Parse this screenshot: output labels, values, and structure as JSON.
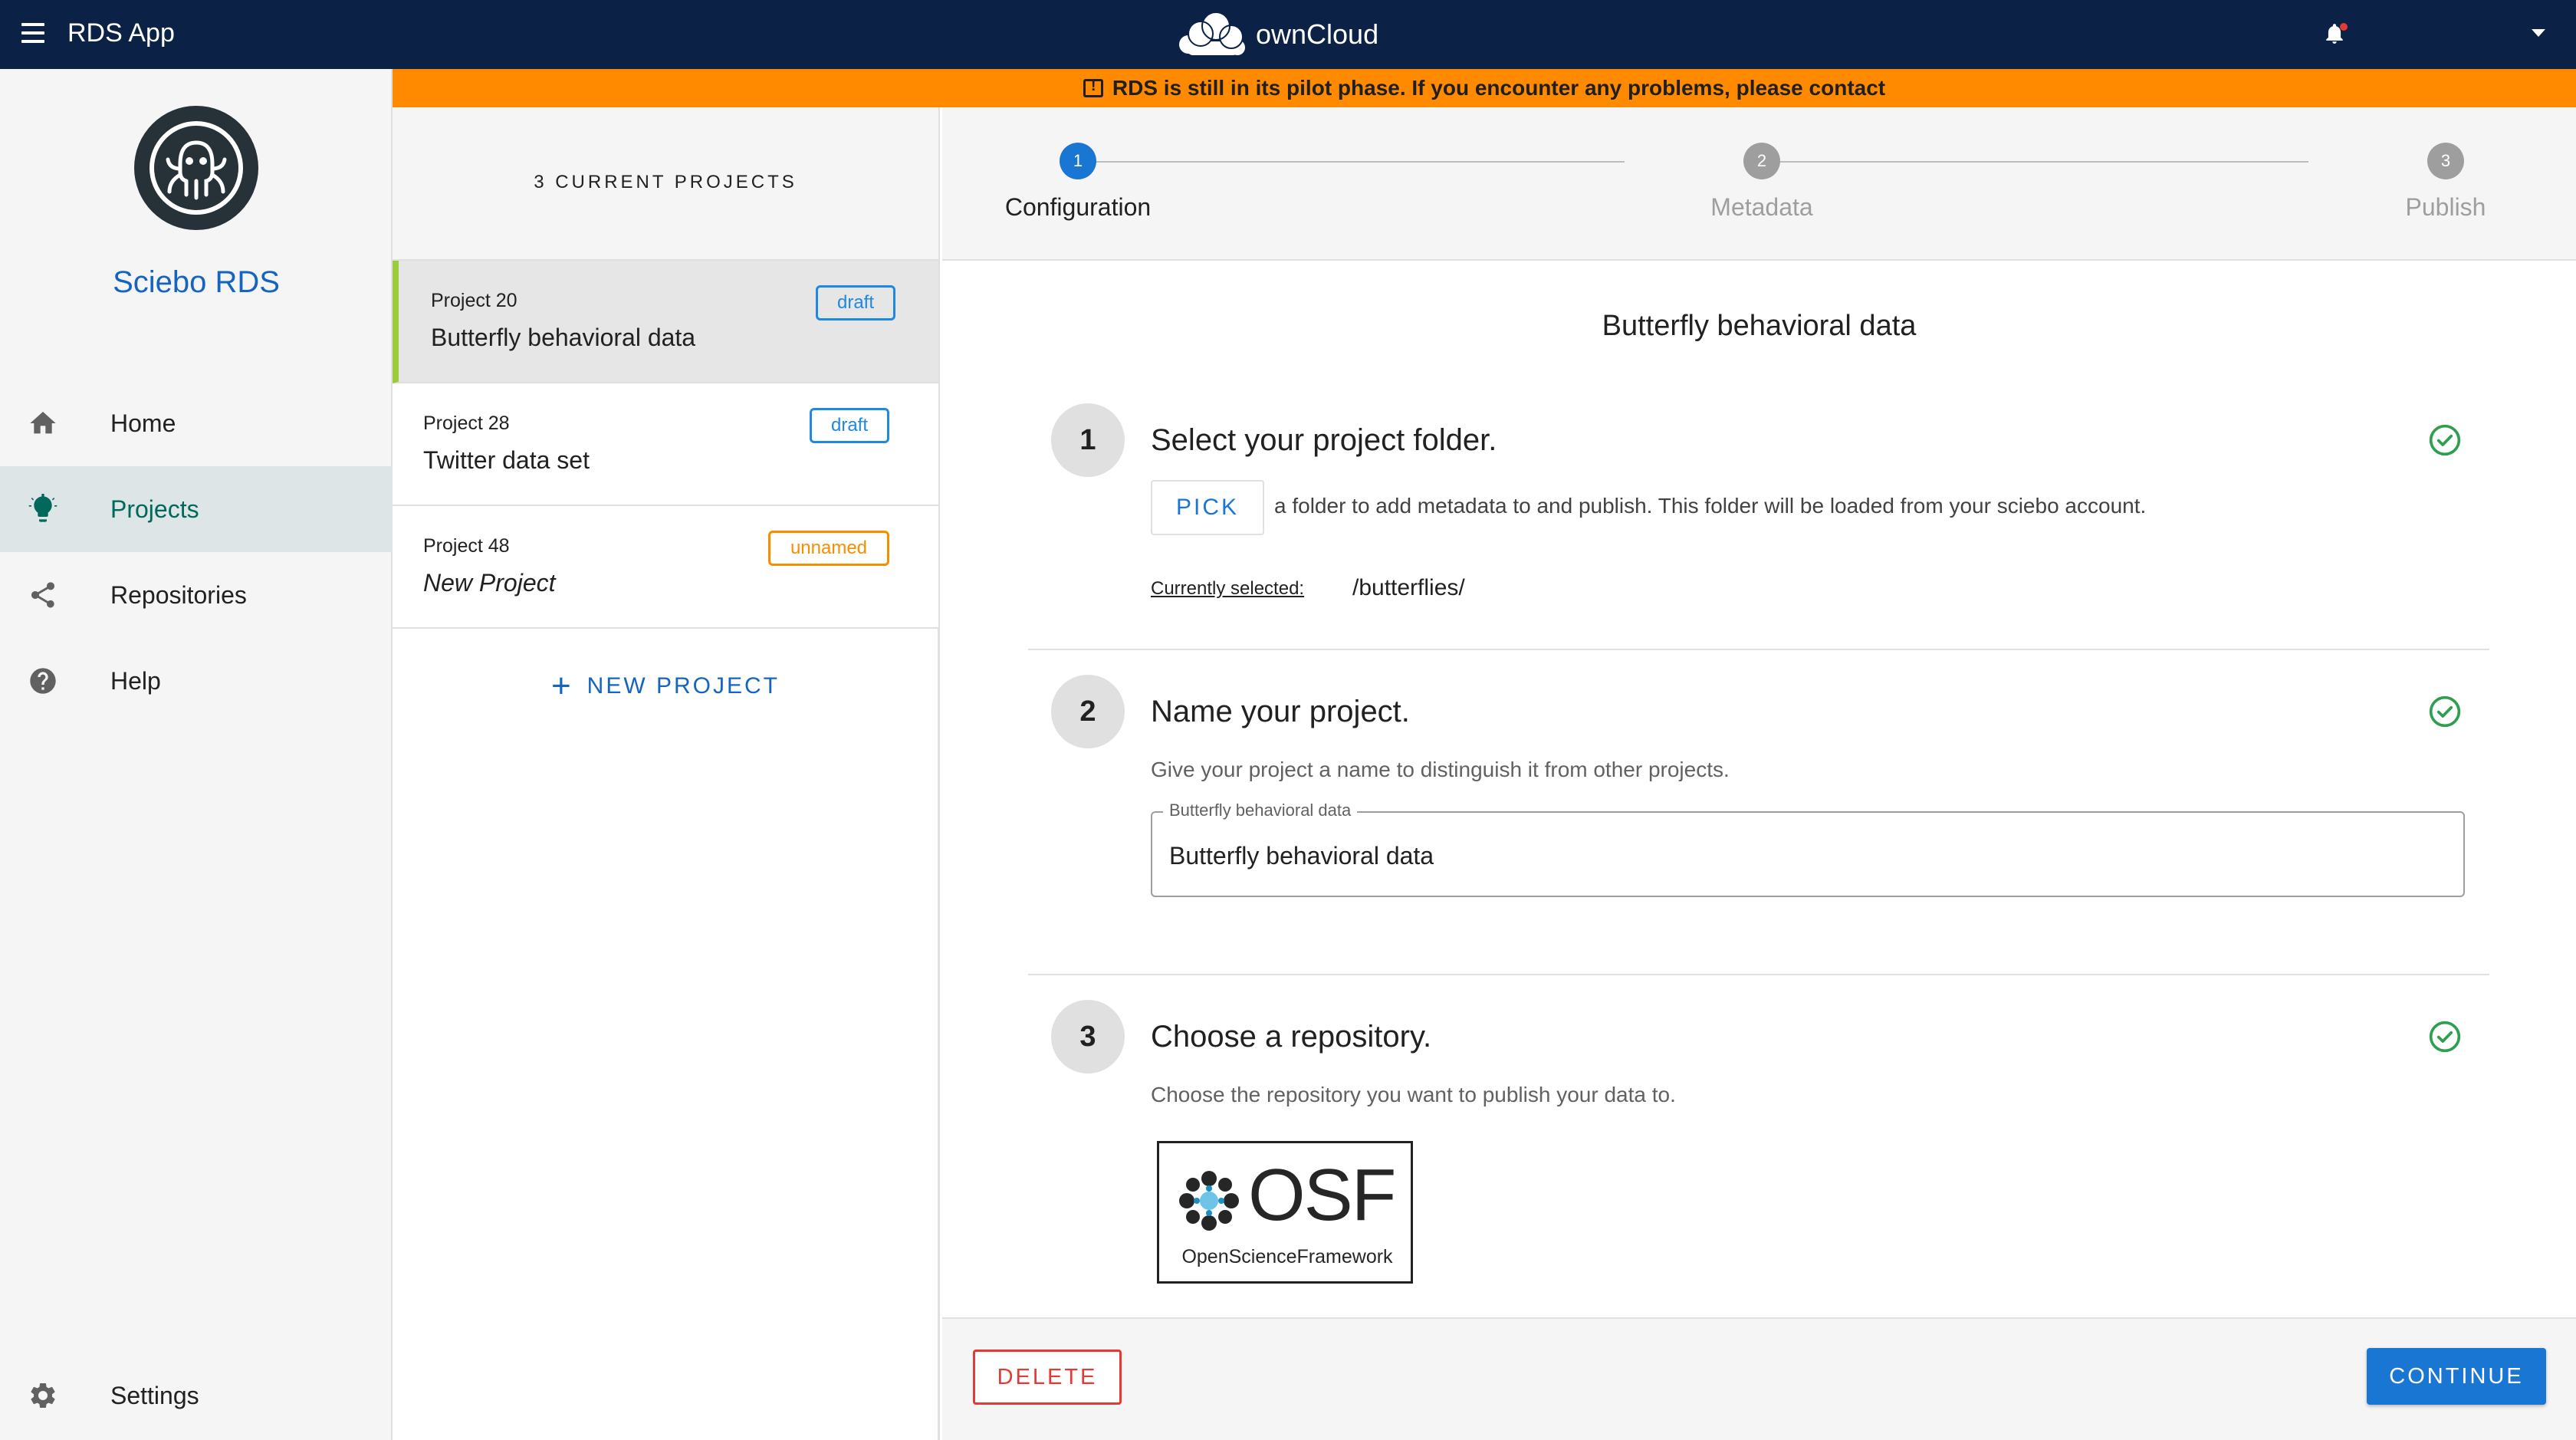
{
  "topbar": {
    "app_title": "RDS App",
    "brand_name": "ownCloud",
    "icons": [
      "menu-icon",
      "owncloud-logo-icon",
      "bell-icon",
      "chevron-down-icon"
    ]
  },
  "banner": {
    "text": "RDS is still in its pilot phase. If you encounter any problems, please contact",
    "color": "#ff8a00"
  },
  "sidebar": {
    "title": "Sciebo RDS",
    "items": [
      {
        "label": "Home",
        "icon": "home-icon"
      },
      {
        "label": "Projects",
        "icon": "lightbulb-icon",
        "active": true
      },
      {
        "label": "Repositories",
        "icon": "share-icon"
      },
      {
        "label": "Help",
        "icon": "help-icon"
      }
    ],
    "settings": {
      "label": "Settings",
      "icon": "gear-icon"
    }
  },
  "projects": {
    "count_label": "3 CURRENT PROJECTS",
    "items": [
      {
        "number": "Project 20",
        "name": "Butterfly behavioral data",
        "status": "draft",
        "selected": true
      },
      {
        "number": "Project 28",
        "name": "Twitter data set",
        "status": "draft"
      },
      {
        "number": "Project 48",
        "name": "New Project",
        "status": "unnamed"
      }
    ],
    "new_label": "NEW PROJECT"
  },
  "stepper": {
    "steps": [
      {
        "num": "1",
        "label": "Configuration",
        "active": true
      },
      {
        "num": "2",
        "label": "Metadata"
      },
      {
        "num": "3",
        "label": "Publish"
      }
    ]
  },
  "form": {
    "title": "Butterfly behavioral data",
    "sections": [
      {
        "num": "1",
        "title": "Select your project folder.",
        "pick_label": "PICK",
        "pick_desc": "a folder to add metadata to and publish. This folder will be loaded from your sciebo account.",
        "selected_label": "Currently selected:",
        "selected_value": "/butterflies/",
        "complete": true
      },
      {
        "num": "2",
        "title": "Name your project.",
        "desc": "Give your project a name to distinguish it from other projects.",
        "field_label": "Butterfly behavioral data",
        "field_value": "Butterfly behavioral data",
        "complete": true
      },
      {
        "num": "3",
        "title": "Choose a repository.",
        "desc": "Choose the repository you want to publish your data to.",
        "repo_name": "OSF",
        "repo_subtitle": "OpenScienceFramework",
        "complete": true
      }
    ]
  },
  "footer": {
    "delete_label": "DELETE",
    "continue_label": "CONTINUE"
  },
  "colors": {
    "topbar": "#0b2146",
    "accent_blue": "#1976d2",
    "success_green": "#2e9e4f",
    "danger_red": "#e53935",
    "selected_border": "#9ccc3c"
  }
}
